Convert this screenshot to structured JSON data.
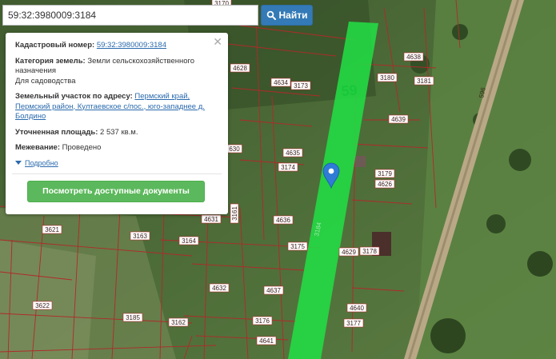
{
  "search": {
    "value": "59:32:3980009:3184",
    "button_label": "Найти"
  },
  "popup": {
    "cadastral_label": "Кадастровый номер:",
    "cadastral_value": "59:32:3980009:3184",
    "category_label": "Категория земель:",
    "category_value": "Земли сельскохозяйственного назначения",
    "usage_value": "Для садоводства",
    "address_label": "Земельный участок по адресу:",
    "address_value": "Пермский край, Пермский район, Култаевское с/пос., юго-западнее д. Болдино",
    "area_label": "Уточненная площадь:",
    "area_value": "2 537 кв.м.",
    "survey_label": "Межевание:",
    "survey_value": "Проведено",
    "more_label": "Подробно",
    "docs_button": "Посмотреть доступные документы"
  },
  "map": {
    "road_number": "596",
    "zone_label": "59",
    "strip_label": "3184",
    "parcel_labels": [
      "3170",
      "4628",
      "4634",
      "3173",
      "3180",
      "3181",
      "4638",
      "4639",
      "630",
      "4635",
      "3174",
      "3179",
      "4626",
      "3161",
      "4631",
      "4636",
      "3621",
      "3163",
      "3164",
      "3175",
      "4629",
      "3178",
      "4632",
      "4637",
      "3622",
      "3185",
      "3162",
      "3176",
      "4640",
      "3177",
      "4641"
    ]
  }
}
